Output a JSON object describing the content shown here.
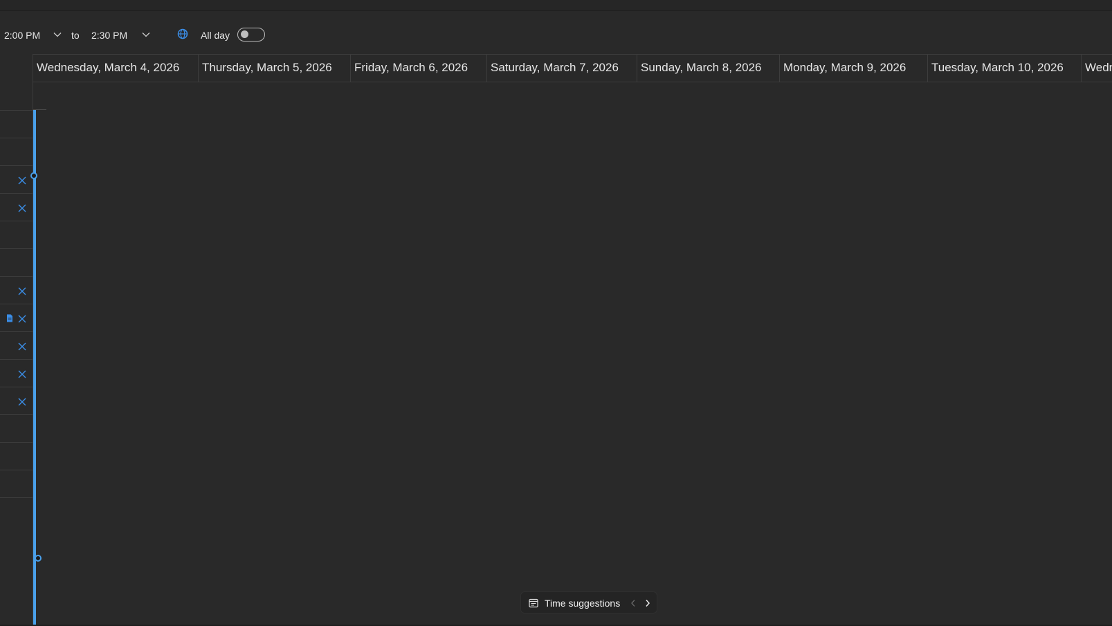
{
  "toolbar": {
    "start_time": "2:00 PM",
    "to_label": "to",
    "end_time": "2:30 PM",
    "all_day_label": "All day",
    "all_day_on": false
  },
  "days": [
    {
      "label": "Wednesday, March 4, 2026"
    },
    {
      "label": "Thursday, March 5, 2026"
    },
    {
      "label": "Friday, March 6, 2026"
    },
    {
      "label": "Saturday, March 7, 2026"
    },
    {
      "label": "Sunday, March 8, 2026"
    },
    {
      "label": "Monday, March 9, 2026"
    },
    {
      "label": "Tuesday, March 10, 2026"
    },
    {
      "label": "Wedn"
    }
  ],
  "attendee_rows": [
    {
      "status": "none"
    },
    {
      "status": "none"
    },
    {
      "status": "none"
    },
    {
      "status": "declined"
    },
    {
      "status": "declined"
    },
    {
      "status": "none"
    },
    {
      "status": "none"
    },
    {
      "status": "declined"
    },
    {
      "status": "declined",
      "has_note": true
    },
    {
      "status": "declined"
    },
    {
      "status": "declined"
    },
    {
      "status": "declined"
    },
    {
      "status": "none"
    },
    {
      "status": "none"
    },
    {
      "status": "none"
    }
  ],
  "time_suggestions": {
    "label": "Time suggestions"
  },
  "colors": {
    "accent": "#4aa0ea",
    "decline_icon": "#3b8ee8",
    "background": "#292929"
  }
}
